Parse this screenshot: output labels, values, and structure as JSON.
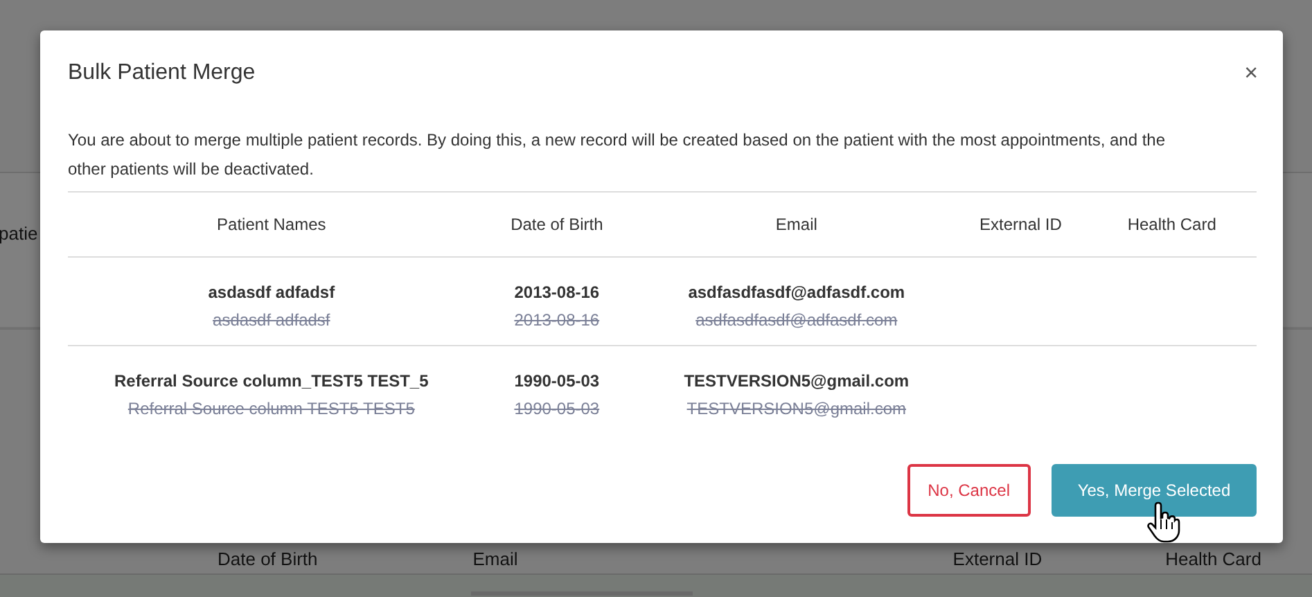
{
  "background_page": {
    "partial_label": "patie",
    "table_columns": [
      "Date of Birth",
      "Email",
      "External ID",
      "Health Card"
    ]
  },
  "dialog": {
    "title": "Bulk Patient Merge",
    "close": "×",
    "message": "You are about to merge multiple patient records. By doing this, a new record will be created based on the patient with the most appointments, and the other patients will be deactivated.",
    "table": {
      "columns": [
        "Patient Names",
        "Date of Birth",
        "Email",
        "External ID",
        "Health Card"
      ],
      "rows": [
        {
          "cells": [
            {
              "value": "asdasdf adfadsf",
              "previous": "asdasdf adfadsf"
            },
            {
              "value": "2013-08-16",
              "previous": "2013-08-16"
            },
            {
              "value": "asdfasdfasdf@adfasdf.com",
              "previous": "asdfasdfasdf@adfasdf.com"
            },
            {},
            {}
          ]
        },
        {
          "cells": [
            {
              "value": "Referral Source column_TEST5 TEST_5",
              "previous": "Referral Source column TEST5 TEST5"
            },
            {
              "value": "1990-05-03",
              "previous": "1990-05-03"
            },
            {
              "value": "TESTVERSION5@gmail.com",
              "previous": "TESTVERSION5@gmail.com"
            },
            {},
            {}
          ]
        }
      ]
    },
    "buttons": [
      {
        "label": "No, Cancel",
        "kind": "outline"
      },
      {
        "label": "Yes, Merge Selected",
        "kind": "primary"
      }
    ]
  }
}
